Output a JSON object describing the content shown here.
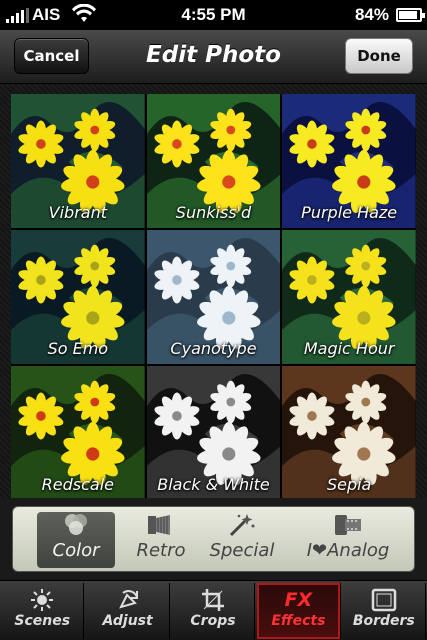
{
  "status": {
    "carrier": "AIS",
    "time": "4:55 PM",
    "battery": "84%",
    "battery_level": 0.84
  },
  "nav": {
    "title": "Edit Photo",
    "cancel_label": "Cancel",
    "done_label": "Done"
  },
  "filters": [
    {
      "label": "Vibrant",
      "bg": "#0f1e2a",
      "leaf": "#2f7f3a",
      "petal": "#f6e012",
      "center": "#d0401a"
    },
    {
      "label": "Sunkiss'd",
      "bg": "#0e2414",
      "leaf": "#3a9a3c",
      "petal": "#ffe31a",
      "center": "#d84a1c"
    },
    {
      "label": "Purple Haze",
      "bg": "#0a1040",
      "leaf": "#2a3fa8",
      "petal": "#f8ea20",
      "center": "#c83d18"
    },
    {
      "label": "So Emo",
      "bg": "#0a1a24",
      "leaf": "#235a4a",
      "petal": "#f2e41c",
      "center": "#a8a41a"
    },
    {
      "label": "Cyanotype",
      "bg": "#2a3c4c",
      "leaf": "#4a6d88",
      "petal": "#eef3f7",
      "center": "#9fb7cc"
    },
    {
      "label": "Magic Hour",
      "bg": "#102a1a",
      "leaf": "#3a9050",
      "petal": "#f6e21a",
      "center": "#b8b020"
    },
    {
      "label": "Redscale",
      "bg": "#13240e",
      "leaf": "#367a20",
      "petal": "#f8e012",
      "center": "#d03a14"
    },
    {
      "label": "Black & White",
      "bg": "#111111",
      "leaf": "#5a5a5a",
      "petal": "#f2f2f2",
      "center": "#8a8a8a"
    },
    {
      "label": "Sepia",
      "bg": "#24140a",
      "leaf": "#8a5430",
      "petal": "#f2ead8",
      "center": "#a07850"
    }
  ],
  "categories": [
    {
      "label": "Color",
      "icon": "color-circles-icon",
      "selected": true
    },
    {
      "label": "Retro",
      "icon": "camera-bellows-icon",
      "selected": false
    },
    {
      "label": "Special",
      "icon": "magic-wand-icon",
      "selected": false
    },
    {
      "label": "I❤Analog",
      "icon": "film-roll-icon",
      "selected": false
    }
  ],
  "tabs": [
    {
      "label": "Scenes",
      "icon": "sun-icon",
      "selected": false
    },
    {
      "label": "Adjust",
      "icon": "rotate-arrow-icon",
      "selected": false
    },
    {
      "label": "Crops",
      "icon": "crop-icon",
      "selected": false
    },
    {
      "label": "Effects",
      "icon_text": "FX",
      "selected": true
    },
    {
      "label": "Borders",
      "icon": "frame-icon",
      "selected": false
    }
  ]
}
